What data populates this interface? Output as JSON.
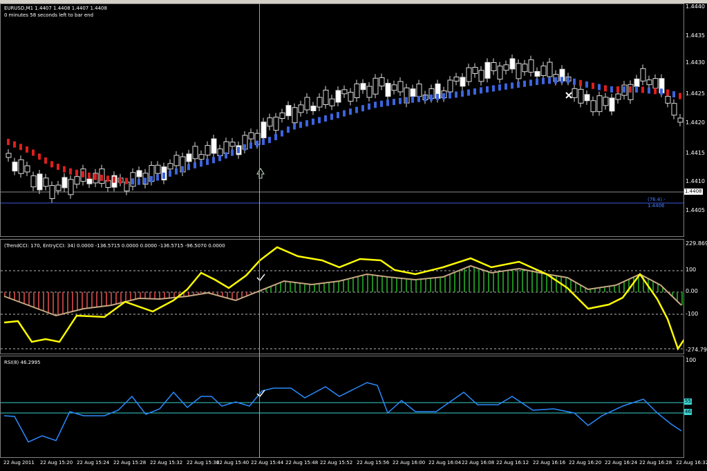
{
  "main_pane": {
    "title": "EURUSD,M1  1.4407 1.4408 1.4407 1.4408",
    "subtitle": "0 minutes 58 seconds left to bar end",
    "price_scale": [
      "1.4440",
      "1.4435",
      "1.4430",
      "1.4425",
      "1.4420",
      "1.4415",
      "1.4410",
      "1.4405"
    ],
    "current_price": "1.4408",
    "fib_label": "(76.4) - 1.4406"
  },
  "cci_pane": {
    "title": "(TrendCCI: 170, EntryCCI: 34)  0.0000 -136.5715 0.0000 0.0000 -136.5715 -96.5070 0.0000",
    "scale_top": "229.8698",
    "scale": [
      "100",
      "0.00",
      "-100"
    ],
    "scale_bottom": "-274.791"
  },
  "rsi_pane": {
    "title": "RSI(8) 46.2995",
    "scale_top": "100",
    "level_high": "55",
    "level_low": "46"
  },
  "time_axis": [
    "22 Aug 2011",
    "22 Aug 15:20",
    "22 Aug 15:24",
    "22 Aug 15:28",
    "22 Aug 15:32",
    "22 Aug 15:36",
    "22 Aug 15:40",
    "22 Aug 15:44",
    "22 Aug 15:48",
    "22 Aug 15:52",
    "22 Aug 15:56",
    "22 Aug 16:00",
    "22 Aug 16:04",
    "22 Aug 16:08",
    "22 Aug 16:12",
    "22 Aug 16:16",
    "22 Aug 16:20",
    "22 Aug 16:24",
    "22 Aug 16:28",
    "22 Aug 16:32"
  ],
  "colors": {
    "background": "#000000",
    "cursor": "#37d2d2",
    "cci_trend": "#ffff00",
    "cci_entry": "#c8a882",
    "hist_up": "#1e8c1e",
    "hist_down": "#b43c3c",
    "rsi": "#2a8cff",
    "ma_up": "#3c64dc",
    "ma_down": "#dc1e1e"
  }
}
